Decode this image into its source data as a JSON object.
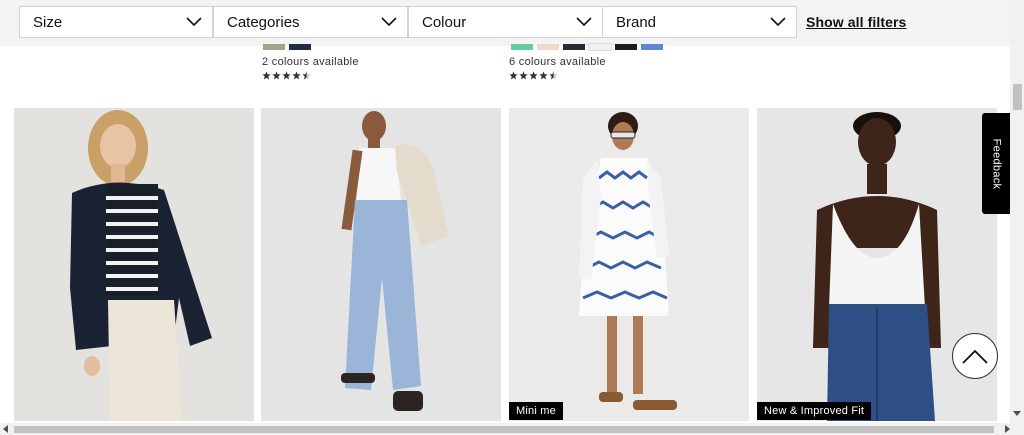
{
  "filters": [
    {
      "label": "Size"
    },
    {
      "label": "Categories"
    },
    {
      "label": "Colour"
    },
    {
      "label": "Brand"
    }
  ],
  "show_all_filters": "Show all filters",
  "previous_row": [
    {
      "swatches": [
        "#a7a08a",
        "#1f2a44"
      ],
      "colours_available": "2 colours available",
      "rating": 4.5
    },
    {
      "swatches": [
        "#5ecf9b",
        "#efd9cd",
        "#262b3b",
        "#f0f0f0",
        "#1c1c1c",
        "#5b87d6"
      ],
      "colours_available": "6 colours available",
      "rating": 4.5
    }
  ],
  "products": [
    {
      "image_icon": "woman-navy-blazer-striped-top-cream-trousers",
      "badge": ""
    },
    {
      "image_icon": "woman-linen-blazer-blue-wide-trousers",
      "badge": ""
    },
    {
      "image_icon": "woman-blue-white-print-mini-dress",
      "badge": "Mini me"
    },
    {
      "image_icon": "woman-white-vest-blue-jeans",
      "badge": "New & Improved Fit"
    }
  ],
  "feedback_label": "Feedback",
  "colors": {
    "filter_bar_bg": "#f3f3f3",
    "badge_bg": "#000000",
    "star": "#333333"
  }
}
